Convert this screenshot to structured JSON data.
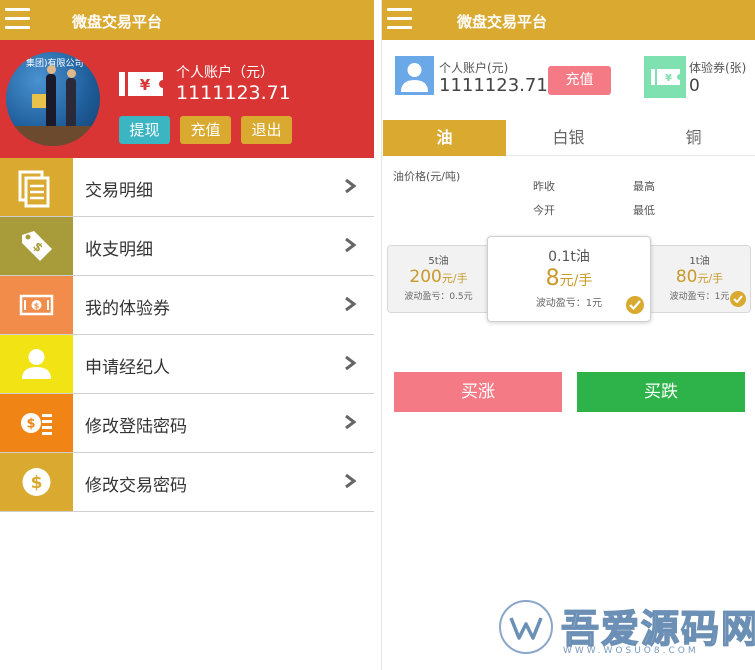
{
  "left": {
    "app_title": "微盘交易平台",
    "avatar_banner": "集团)有限公司",
    "account_label": "个人账户（元）",
    "account_value": "1111123.71",
    "buttons": {
      "withdraw": "提现",
      "deposit": "充值",
      "logout": "退出"
    },
    "menu": [
      {
        "label": "交易明细",
        "icon": "document-list-icon",
        "color": "#d9a930"
      },
      {
        "label": "收支明细",
        "icon": "price-tag-icon",
        "color": "#a89b3a"
      },
      {
        "label": "我的体验券",
        "icon": "cash-voucher-icon",
        "color": "#f18c4a"
      },
      {
        "label": "申请经纪人",
        "icon": "user-icon",
        "color": "#f2e414"
      },
      {
        "label": "修改登陆密码",
        "icon": "coin-stack-icon",
        "color": "#f08516"
      },
      {
        "label": "修改交易密码",
        "icon": "dollar-coin-icon",
        "color": "#d9a930"
      }
    ]
  },
  "right": {
    "app_title": "微盘交易平台",
    "account_label": "个人账户(元)",
    "account_value": "1111123.71",
    "deposit_label": "充值",
    "voucher_label": "体验券(张)",
    "voucher_value": "0",
    "tabs": [
      "油",
      "白银",
      "铜"
    ],
    "price_header": "油价格(元/吨)",
    "stats": {
      "prev_close": "昨收",
      "high": "最高",
      "open": "今开",
      "low": "最低"
    },
    "cards": [
      {
        "name": "5t油",
        "price": "200",
        "unit": "元/手",
        "sub": "波动盈亏：0.5元"
      },
      {
        "name": "0.1t油",
        "price": "8",
        "unit": "元/手",
        "sub": "波动盈亏：1元"
      },
      {
        "name": "1t油",
        "price": "80",
        "unit": "元/手",
        "sub": "波动盈亏：1元"
      }
    ],
    "buy_up": "买涨",
    "buy_down": "买跌"
  },
  "watermark": {
    "text": "吾爱源码网",
    "url": "WWW.WOSUO8.COM"
  },
  "colors": {
    "gold": "#d9a930",
    "red": "#d93535",
    "teal": "#3cb5c3",
    "pink": "#f47b86",
    "green": "#2db34a",
    "blue": "#6aa8e8",
    "mint": "#7fe0b0"
  }
}
